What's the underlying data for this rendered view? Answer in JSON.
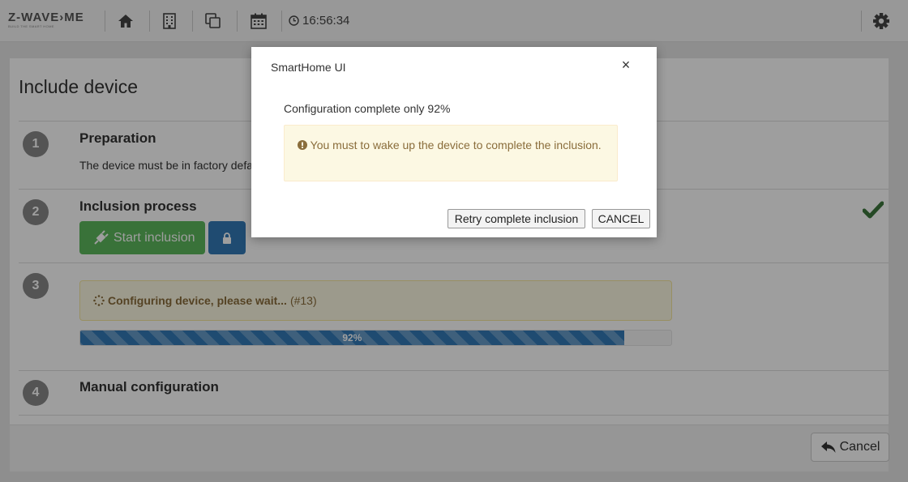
{
  "navbar": {
    "logo_text": "Z-WAVE›ME",
    "logo_sub": "BUILD THE SMART HOME",
    "clock": "16:56:34",
    "icons": [
      "home-icon",
      "building-icon",
      "copy-icon",
      "calendar-icon",
      "clock-icon",
      "gear-icon"
    ]
  },
  "page": {
    "title": "Include device",
    "steps": [
      {
        "num": "1",
        "title": "Preparation",
        "text": "The device must be in factory defa"
      },
      {
        "num": "2",
        "title": "Inclusion process",
        "start_label": "Start inclusion"
      },
      {
        "num": "3",
        "alert_bold": "Configuring device, please wait...",
        "alert_extra": "(#13)",
        "progress_label": "92%",
        "progress": 0.92
      },
      {
        "num": "4",
        "title": "Manual configuration"
      }
    ]
  },
  "footer": {
    "cancel_label": "Cancel"
  },
  "modal": {
    "title": "SmartHome UI",
    "close": "×",
    "message": "Configuration complete only 92%",
    "alert": "You must to wake up the device to complete the inclusion.",
    "retry_label": "Retry complete inclusion",
    "cancel_label": "CANCEL"
  },
  "colors": {
    "success": "#5cb85c",
    "primary": "#337ab7",
    "warning_bg": "#fcf8e3",
    "warning_text": "#8a6d3b",
    "check": "#3c763d"
  }
}
